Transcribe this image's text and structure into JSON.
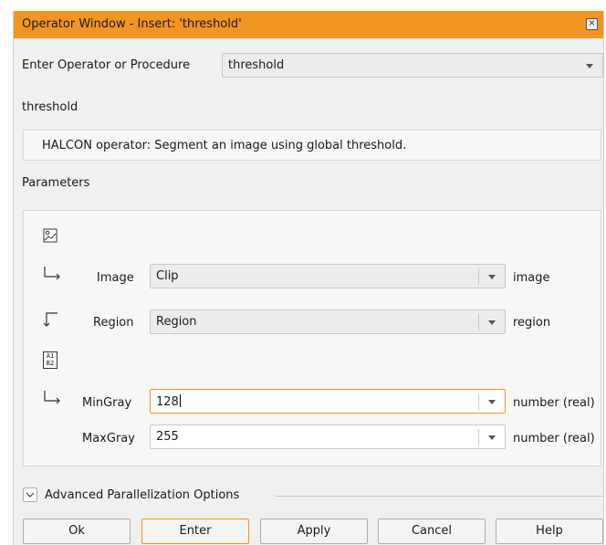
{
  "window": {
    "title": "Operator Window - Insert: 'threshold'",
    "close_glyph": "×"
  },
  "operator": {
    "label": "Enter Operator or Procedure",
    "value": "threshold"
  },
  "description": {
    "heading": "threshold",
    "text": "HALCON operator:  Segment an image using global threshold."
  },
  "parameters": {
    "heading": "Parameters",
    "rows": [
      {
        "name": "Image",
        "value": "Clip",
        "type": "image",
        "icon": "input-arrow-icon"
      },
      {
        "name": "Region",
        "value": "Region",
        "type": "region",
        "icon": "output-arrow-icon"
      },
      {
        "name": "MinGray",
        "value": "128",
        "type": "number (real)",
        "icon": "input-arrow-icon"
      },
      {
        "name": "MaxGray",
        "value": "255",
        "type": "number (real)",
        "icon": ""
      }
    ],
    "iconic_section_icon": "image-icon",
    "control_section_icon": "control-values-icon",
    "control_icon_text": "A1\nB2"
  },
  "advanced": {
    "label": "Advanced Parallelization Options"
  },
  "buttons": {
    "ok": "Ok",
    "enter": "Enter",
    "apply": "Apply",
    "cancel": "Cancel",
    "help": "Help"
  },
  "colors": {
    "accent": "#f29422",
    "background": "#f0f0f0"
  }
}
